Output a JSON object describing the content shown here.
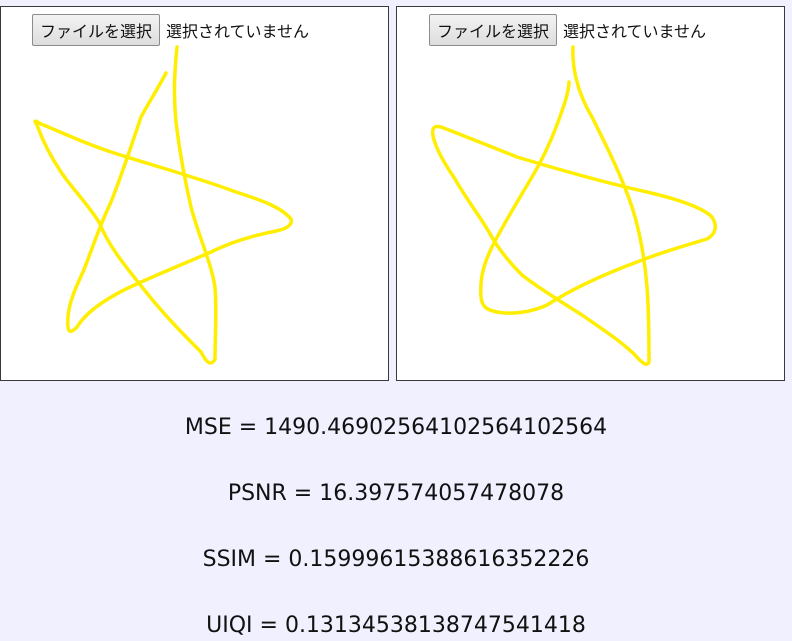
{
  "panels": [
    {
      "file_button_label": "ファイルを選択",
      "file_status": "選択されていません"
    },
    {
      "file_button_label": "ファイルを選択",
      "file_status": "選択されていません"
    }
  ],
  "drawing": {
    "stroke_color": "#ffee00"
  },
  "metrics": {
    "mse": "MSE = 1490.4690256410256410256​4",
    "psnr": "PSNR = 16.397574057478078",
    "ssim": "SSIM = 0.15999615388616352226",
    "uiqi": "UIQI = 0.13134538138747541418"
  }
}
